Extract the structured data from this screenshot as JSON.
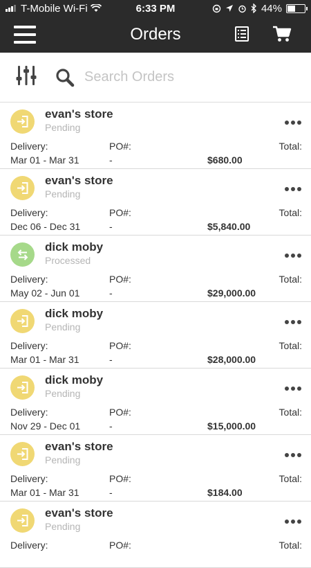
{
  "status_bar": {
    "carrier": "T-Mobile Wi-Fi",
    "time": "6:33 PM",
    "battery": "44%",
    "battery_level": 0.44
  },
  "header": {
    "title": "Orders"
  },
  "search": {
    "placeholder": "Search Orders",
    "value": ""
  },
  "labels": {
    "delivery": "Delivery:",
    "po": "PO#:",
    "total": "Total:"
  },
  "colors": {
    "pending": "#f0d874",
    "processed": "#a6d98a",
    "header_bg": "#2b2b2b"
  },
  "orders": [
    {
      "store": "evan's store",
      "status": "Pending",
      "status_icon": "enter-icon",
      "delivery": "Mar 01 - Mar 31",
      "po": "-",
      "total": "$680.00"
    },
    {
      "store": "evan's store",
      "status": "Pending",
      "status_icon": "enter-icon",
      "delivery": "Dec 06 - Dec 31",
      "po": "-",
      "total": "$5,840.00"
    },
    {
      "store": "dick moby",
      "status": "Processed",
      "status_icon": "swap-arrows-icon",
      "delivery": "May 02 - Jun 01",
      "po": "-",
      "total": "$29,000.00"
    },
    {
      "store": "dick moby",
      "status": "Pending",
      "status_icon": "enter-icon",
      "delivery": "Mar 01 - Mar 31",
      "po": "-",
      "total": "$28,000.00"
    },
    {
      "store": "dick moby",
      "status": "Pending",
      "status_icon": "enter-icon",
      "delivery": "Nov 29 - Dec 01",
      "po": "-",
      "total": "$15,000.00"
    },
    {
      "store": "evan's store",
      "status": "Pending",
      "status_icon": "enter-icon",
      "delivery": "Mar 01 - Mar 31",
      "po": "-",
      "total": "$184.00"
    },
    {
      "store": "evan's store",
      "status": "Pending",
      "status_icon": "enter-icon",
      "delivery": "",
      "po": "",
      "total": ""
    }
  ]
}
